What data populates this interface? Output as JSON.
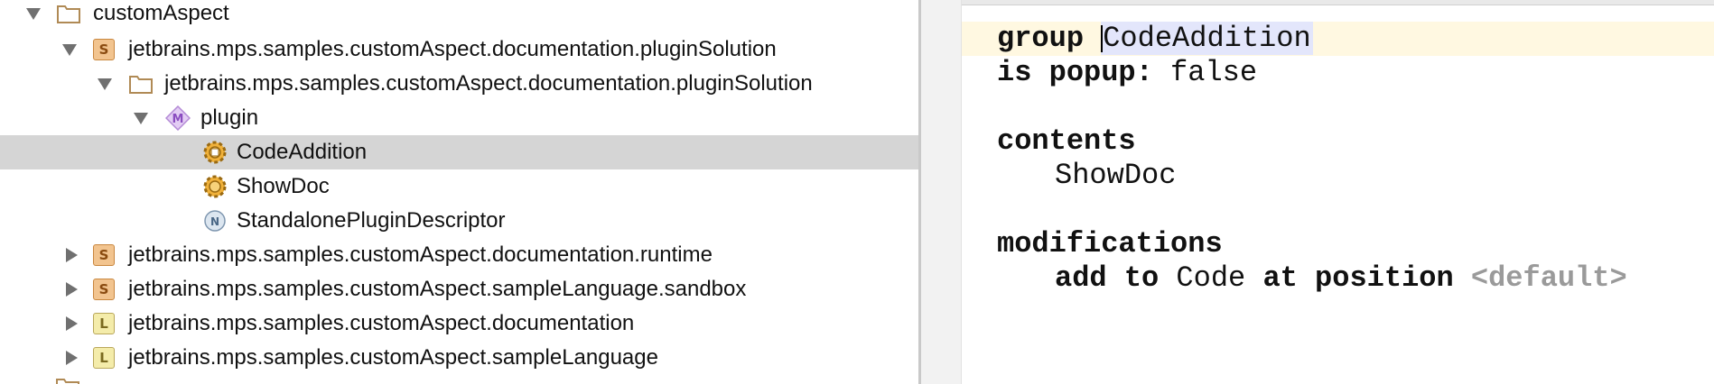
{
  "tree": {
    "rows": [
      {
        "label": "customAspect",
        "icon": "folder-icon",
        "expanded": true
      },
      {
        "label": "jetbrains.mps.samples.customAspect.documentation.pluginSolution",
        "icon": "solution-icon",
        "badge": "S",
        "expanded": true
      },
      {
        "label": "jetbrains.mps.samples.customAspect.documentation.pluginSolution",
        "icon": "folder-icon",
        "expanded": true
      },
      {
        "label": "plugin",
        "icon": "model-icon",
        "badge": "M",
        "expanded": true
      },
      {
        "label": "CodeAddition",
        "icon": "action-group-icon",
        "selected": true
      },
      {
        "label": "ShowDoc",
        "icon": "action-icon"
      },
      {
        "label": "StandalonePluginDescriptor",
        "icon": "node-icon",
        "badge": "N"
      },
      {
        "label": "jetbrains.mps.samples.customAspect.documentation.runtime",
        "icon": "solution-icon",
        "badge": "S",
        "expanded": false
      },
      {
        "label": "jetbrains.mps.samples.customAspect.sampleLanguage.sandbox",
        "icon": "solution-icon",
        "badge": "S",
        "expanded": false
      },
      {
        "label": "jetbrains.mps.samples.customAspect.documentation",
        "icon": "language-icon",
        "badge": "L",
        "expanded": false
      },
      {
        "label": "jetbrains.mps.samples.customAspect.sampleLanguage",
        "icon": "language-icon",
        "badge": "L",
        "expanded": false
      }
    ]
  },
  "editor": {
    "group_kw": "group",
    "group_name": "CodeAddition",
    "popup_kw": "is popup:",
    "popup_value": "false",
    "contents_kw": "contents",
    "contents_item": "ShowDoc",
    "modifications_kw": "modifications",
    "add_to_kw": "add to",
    "add_to_target": "Code",
    "at_position_kw": "at position",
    "position_value": "<default>"
  }
}
